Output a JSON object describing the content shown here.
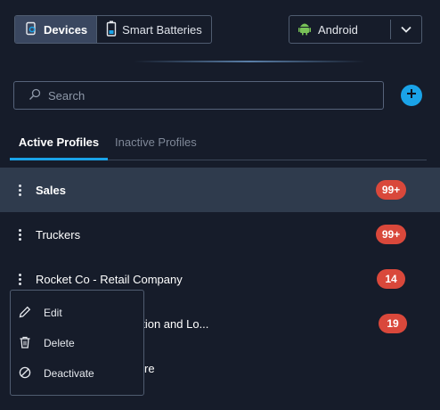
{
  "platform_tabs": {
    "devices": "Devices",
    "smart_batteries": "Smart Batteries"
  },
  "platform_select": {
    "value": "Android"
  },
  "search": {
    "placeholder": "Search"
  },
  "profile_tabs": {
    "active": "Active Profiles",
    "inactive": "Inactive Profiles"
  },
  "profiles": [
    {
      "name": "Sales",
      "badge": "99+"
    },
    {
      "name": "Truckers",
      "badge": "99+"
    },
    {
      "name": "Rocket Co - Retail Company",
      "badge": "14"
    },
    {
      "name": "ation and Lo...",
      "badge": "19"
    },
    {
      "name": "re",
      "badge": ""
    }
  ],
  "context_menu": {
    "edit": "Edit",
    "delete": "Delete",
    "deactivate": "Deactivate"
  },
  "colors": {
    "accent": "#1aa3e8",
    "badge": "#d9483b",
    "android": "#78c257"
  }
}
